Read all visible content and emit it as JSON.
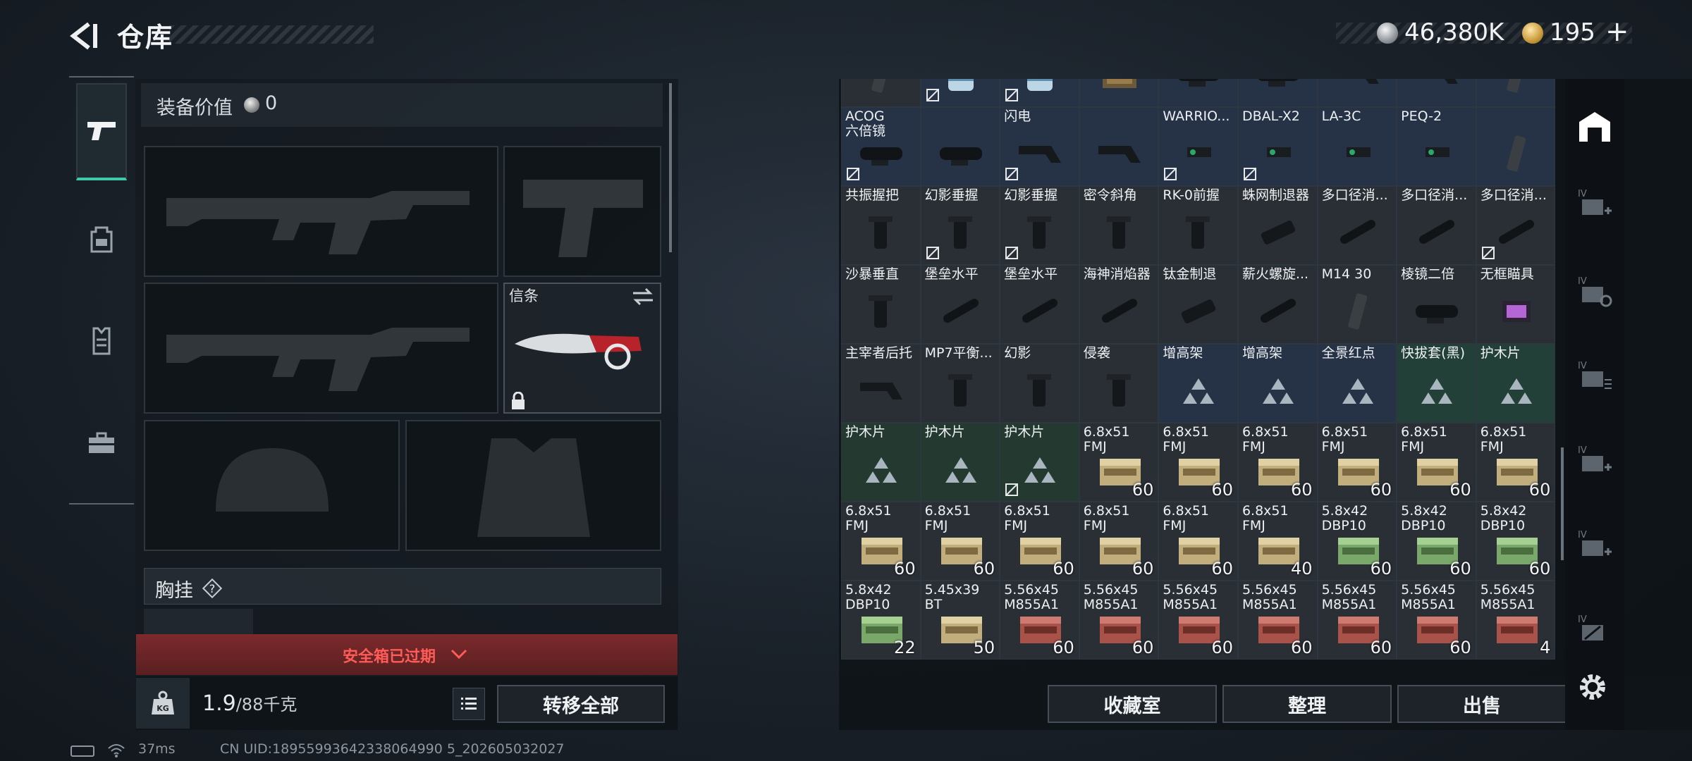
{
  "header": {
    "title": "仓库",
    "money": "46,380K",
    "gold": "195",
    "gold_plus": "+"
  },
  "left_tabs": [
    "weapons",
    "backpack",
    "chest-rig",
    "case"
  ],
  "equipment": {
    "value_label": "装备价值",
    "value": "0",
    "melee_label": "信条",
    "chest_label": "胸挂",
    "chest_help": "?",
    "safe_box_text": "安全箱已过期",
    "weight": "1.9",
    "weight_max": "/88千克",
    "transfer_all": "转移全部",
    "kg_icon_text": "KG"
  },
  "storage": {
    "cells": [
      {
        "n": "",
        "q": "",
        "c": "gray",
        "t": false,
        "a": "mag"
      },
      {
        "n": "",
        "q": "",
        "c": "blue",
        "t": true,
        "a": "can"
      },
      {
        "n": "",
        "q": "",
        "c": "blue",
        "t": true,
        "a": "can"
      },
      {
        "n": "",
        "q": "",
        "c": "blue",
        "t": false,
        "a": "card"
      },
      {
        "n": "",
        "q": "",
        "c": "blue",
        "t": false,
        "a": "scope"
      },
      {
        "n": "",
        "q": "",
        "c": "blue",
        "t": false,
        "a": "scope"
      },
      {
        "n": "",
        "q": "",
        "c": "blue",
        "t": false,
        "a": "stock"
      },
      {
        "n": "",
        "q": "",
        "c": "blue",
        "t": false,
        "a": "stock"
      },
      {
        "n": "",
        "q": "",
        "c": "blue",
        "t": false,
        "a": "mag"
      },
      {
        "n": "ACOG\n六倍镜",
        "q": "",
        "c": "blue",
        "t": true,
        "a": "scope"
      },
      {
        "n": "",
        "q": "",
        "c": "blue",
        "t": false,
        "a": "scope"
      },
      {
        "n": "闪电",
        "q": "",
        "c": "blue",
        "t": true,
        "a": "stock"
      },
      {
        "n": "",
        "q": "",
        "c": "blue",
        "t": false,
        "a": "stock"
      },
      {
        "n": "WARRIO...",
        "q": "",
        "c": "blue",
        "t": true,
        "a": "laser"
      },
      {
        "n": "DBAL-X2",
        "q": "",
        "c": "blue",
        "t": true,
        "a": "laser"
      },
      {
        "n": "LA-3C",
        "q": "",
        "c": "blue",
        "t": false,
        "a": "laser"
      },
      {
        "n": "PEQ-2",
        "q": "",
        "c": "blue",
        "t": false,
        "a": "laser"
      },
      {
        "n": "",
        "q": "",
        "c": "blue",
        "t": false,
        "a": "mag"
      },
      {
        "n": "共振握把",
        "q": "",
        "c": "gray",
        "t": false,
        "a": "grip"
      },
      {
        "n": "幻影垂握",
        "q": "",
        "c": "gray",
        "t": true,
        "a": "grip"
      },
      {
        "n": "幻影垂握",
        "q": "",
        "c": "gray",
        "t": true,
        "a": "grip"
      },
      {
        "n": "密令斜角",
        "q": "",
        "c": "gray",
        "t": false,
        "a": "grip"
      },
      {
        "n": "RK-0前握",
        "q": "",
        "c": "gray",
        "t": false,
        "a": "grip"
      },
      {
        "n": "蛛网制退器",
        "q": "",
        "c": "gray",
        "t": false,
        "a": "muzzle"
      },
      {
        "n": "多口径消...",
        "q": "",
        "c": "gray",
        "t": false,
        "a": "tube"
      },
      {
        "n": "多口径消...",
        "q": "",
        "c": "gray",
        "t": false,
        "a": "tube"
      },
      {
        "n": "多口径消...",
        "q": "",
        "c": "gray",
        "t": true,
        "a": "tube"
      },
      {
        "n": "沙暴垂直",
        "q": "",
        "c": "gray",
        "t": false,
        "a": "grip"
      },
      {
        "n": "堡垒水平",
        "q": "",
        "c": "gray",
        "t": false,
        "a": "tube"
      },
      {
        "n": "堡垒水平",
        "q": "",
        "c": "gray",
        "t": false,
        "a": "tube"
      },
      {
        "n": "海神消焰器",
        "q": "",
        "c": "gray",
        "t": false,
        "a": "tube"
      },
      {
        "n": "钛金制退",
        "q": "",
        "c": "gray",
        "t": false,
        "a": "muzzle"
      },
      {
        "n": "薪火螺旋...",
        "q": "",
        "c": "gray",
        "t": false,
        "a": "tube"
      },
      {
        "n": "M14 30",
        "q": "",
        "c": "gray",
        "t": false,
        "a": "mag"
      },
      {
        "n": "棱镜二倍",
        "q": "",
        "c": "gray",
        "t": false,
        "a": "scope"
      },
      {
        "n": "无框瞄具",
        "q": "",
        "c": "gray",
        "t": false,
        "a": "holo"
      },
      {
        "n": "主宰者后托",
        "q": "",
        "c": "gray",
        "t": false,
        "a": "stock"
      },
      {
        "n": "MP7平衡...",
        "q": "",
        "c": "gray",
        "t": false,
        "a": "grip"
      },
      {
        "n": "幻影",
        "q": "",
        "c": "gray",
        "t": false,
        "a": "grip"
      },
      {
        "n": "侵袭",
        "q": "",
        "c": "gray",
        "t": false,
        "a": "grip"
      },
      {
        "n": "增高架",
        "q": "",
        "c": "blue",
        "t": false,
        "a": "tri"
      },
      {
        "n": "增高架",
        "q": "",
        "c": "blue",
        "t": false,
        "a": "tri"
      },
      {
        "n": "全景红点",
        "q": "",
        "c": "blue",
        "t": false,
        "a": "tri"
      },
      {
        "n": "快拔套(黑)",
        "q": "",
        "c": "teal",
        "t": false,
        "a": "tri"
      },
      {
        "n": "护木片",
        "q": "",
        "c": "teal",
        "t": false,
        "a": "tri"
      },
      {
        "n": "护木片",
        "q": "",
        "c": "green",
        "t": false,
        "a": "tri"
      },
      {
        "n": "护木片",
        "q": "",
        "c": "green",
        "t": false,
        "a": "tri"
      },
      {
        "n": "护木片",
        "q": "",
        "c": "green",
        "t": true,
        "a": "tri"
      },
      {
        "n": "6.8x51\nFMJ",
        "q": "60",
        "c": "gray",
        "t": false,
        "a": "ammo-tan"
      },
      {
        "n": "6.8x51\nFMJ",
        "q": "60",
        "c": "gray",
        "t": false,
        "a": "ammo-tan"
      },
      {
        "n": "6.8x51\nFMJ",
        "q": "60",
        "c": "gray",
        "t": false,
        "a": "ammo-tan"
      },
      {
        "n": "6.8x51\nFMJ",
        "q": "60",
        "c": "gray",
        "t": false,
        "a": "ammo-tan"
      },
      {
        "n": "6.8x51\nFMJ",
        "q": "60",
        "c": "gray",
        "t": false,
        "a": "ammo-tan"
      },
      {
        "n": "6.8x51\nFMJ",
        "q": "60",
        "c": "gray",
        "t": false,
        "a": "ammo-tan"
      },
      {
        "n": "6.8x51\nFMJ",
        "q": "60",
        "c": "gray",
        "t": false,
        "a": "ammo-tan"
      },
      {
        "n": "6.8x51\nFMJ",
        "q": "60",
        "c": "gray",
        "t": false,
        "a": "ammo-tan"
      },
      {
        "n": "6.8x51\nFMJ",
        "q": "60",
        "c": "gray",
        "t": false,
        "a": "ammo-tan"
      },
      {
        "n": "6.8x51\nFMJ",
        "q": "60",
        "c": "gray",
        "t": false,
        "a": "ammo-tan"
      },
      {
        "n": "6.8x51\nFMJ",
        "q": "60",
        "c": "gray",
        "t": false,
        "a": "ammo-tan"
      },
      {
        "n": "6.8x51\nFMJ",
        "q": "40",
        "c": "gray",
        "t": false,
        "a": "ammo-tan"
      },
      {
        "n": "5.8x42\nDBP10",
        "q": "60",
        "c": "gray",
        "t": false,
        "a": "ammo-green"
      },
      {
        "n": "5.8x42\nDBP10",
        "q": "60",
        "c": "gray",
        "t": false,
        "a": "ammo-green"
      },
      {
        "n": "5.8x42\nDBP10",
        "q": "60",
        "c": "gray",
        "t": false,
        "a": "ammo-green"
      },
      {
        "n": "5.8x42\nDBP10",
        "q": "22",
        "c": "gray",
        "t": false,
        "a": "ammo-green"
      },
      {
        "n": "5.45x39\nBT",
        "q": "50",
        "c": "gray",
        "t": false,
        "a": "ammo-tan"
      },
      {
        "n": "5.56x45\nM855A1",
        "q": "60",
        "c": "gray",
        "t": false,
        "a": "ammo-red"
      },
      {
        "n": "5.56x45\nM855A1",
        "q": "60",
        "c": "gray",
        "t": false,
        "a": "ammo-red"
      },
      {
        "n": "5.56x45\nM855A1",
        "q": "60",
        "c": "gray",
        "t": false,
        "a": "ammo-red"
      },
      {
        "n": "5.56x45\nM855A1",
        "q": "60",
        "c": "gray",
        "t": false,
        "a": "ammo-red"
      },
      {
        "n": "5.56x45\nM855A1",
        "q": "60",
        "c": "gray",
        "t": false,
        "a": "ammo-red"
      },
      {
        "n": "5.56x45\nM855A1",
        "q": "60",
        "c": "gray",
        "t": false,
        "a": "ammo-red"
      },
      {
        "n": "5.56x45\nM855A1",
        "q": "4",
        "c": "gray",
        "t": false,
        "a": "ammo-red"
      }
    ],
    "buttons": {
      "collection": "收藏室",
      "sort": "整理",
      "sell": "出售"
    }
  },
  "right_tabs": [
    "warehouse",
    "IV",
    "IV",
    "IV",
    "IV",
    "IV",
    "IV"
  ],
  "status": {
    "ping": "37ms",
    "uid": "CN UID:18955993642338064990 5_202605032027"
  },
  "colors": {
    "accent": "#3fc9a8",
    "danger": "#ff5b57",
    "banner": "#7c2a2c"
  }
}
